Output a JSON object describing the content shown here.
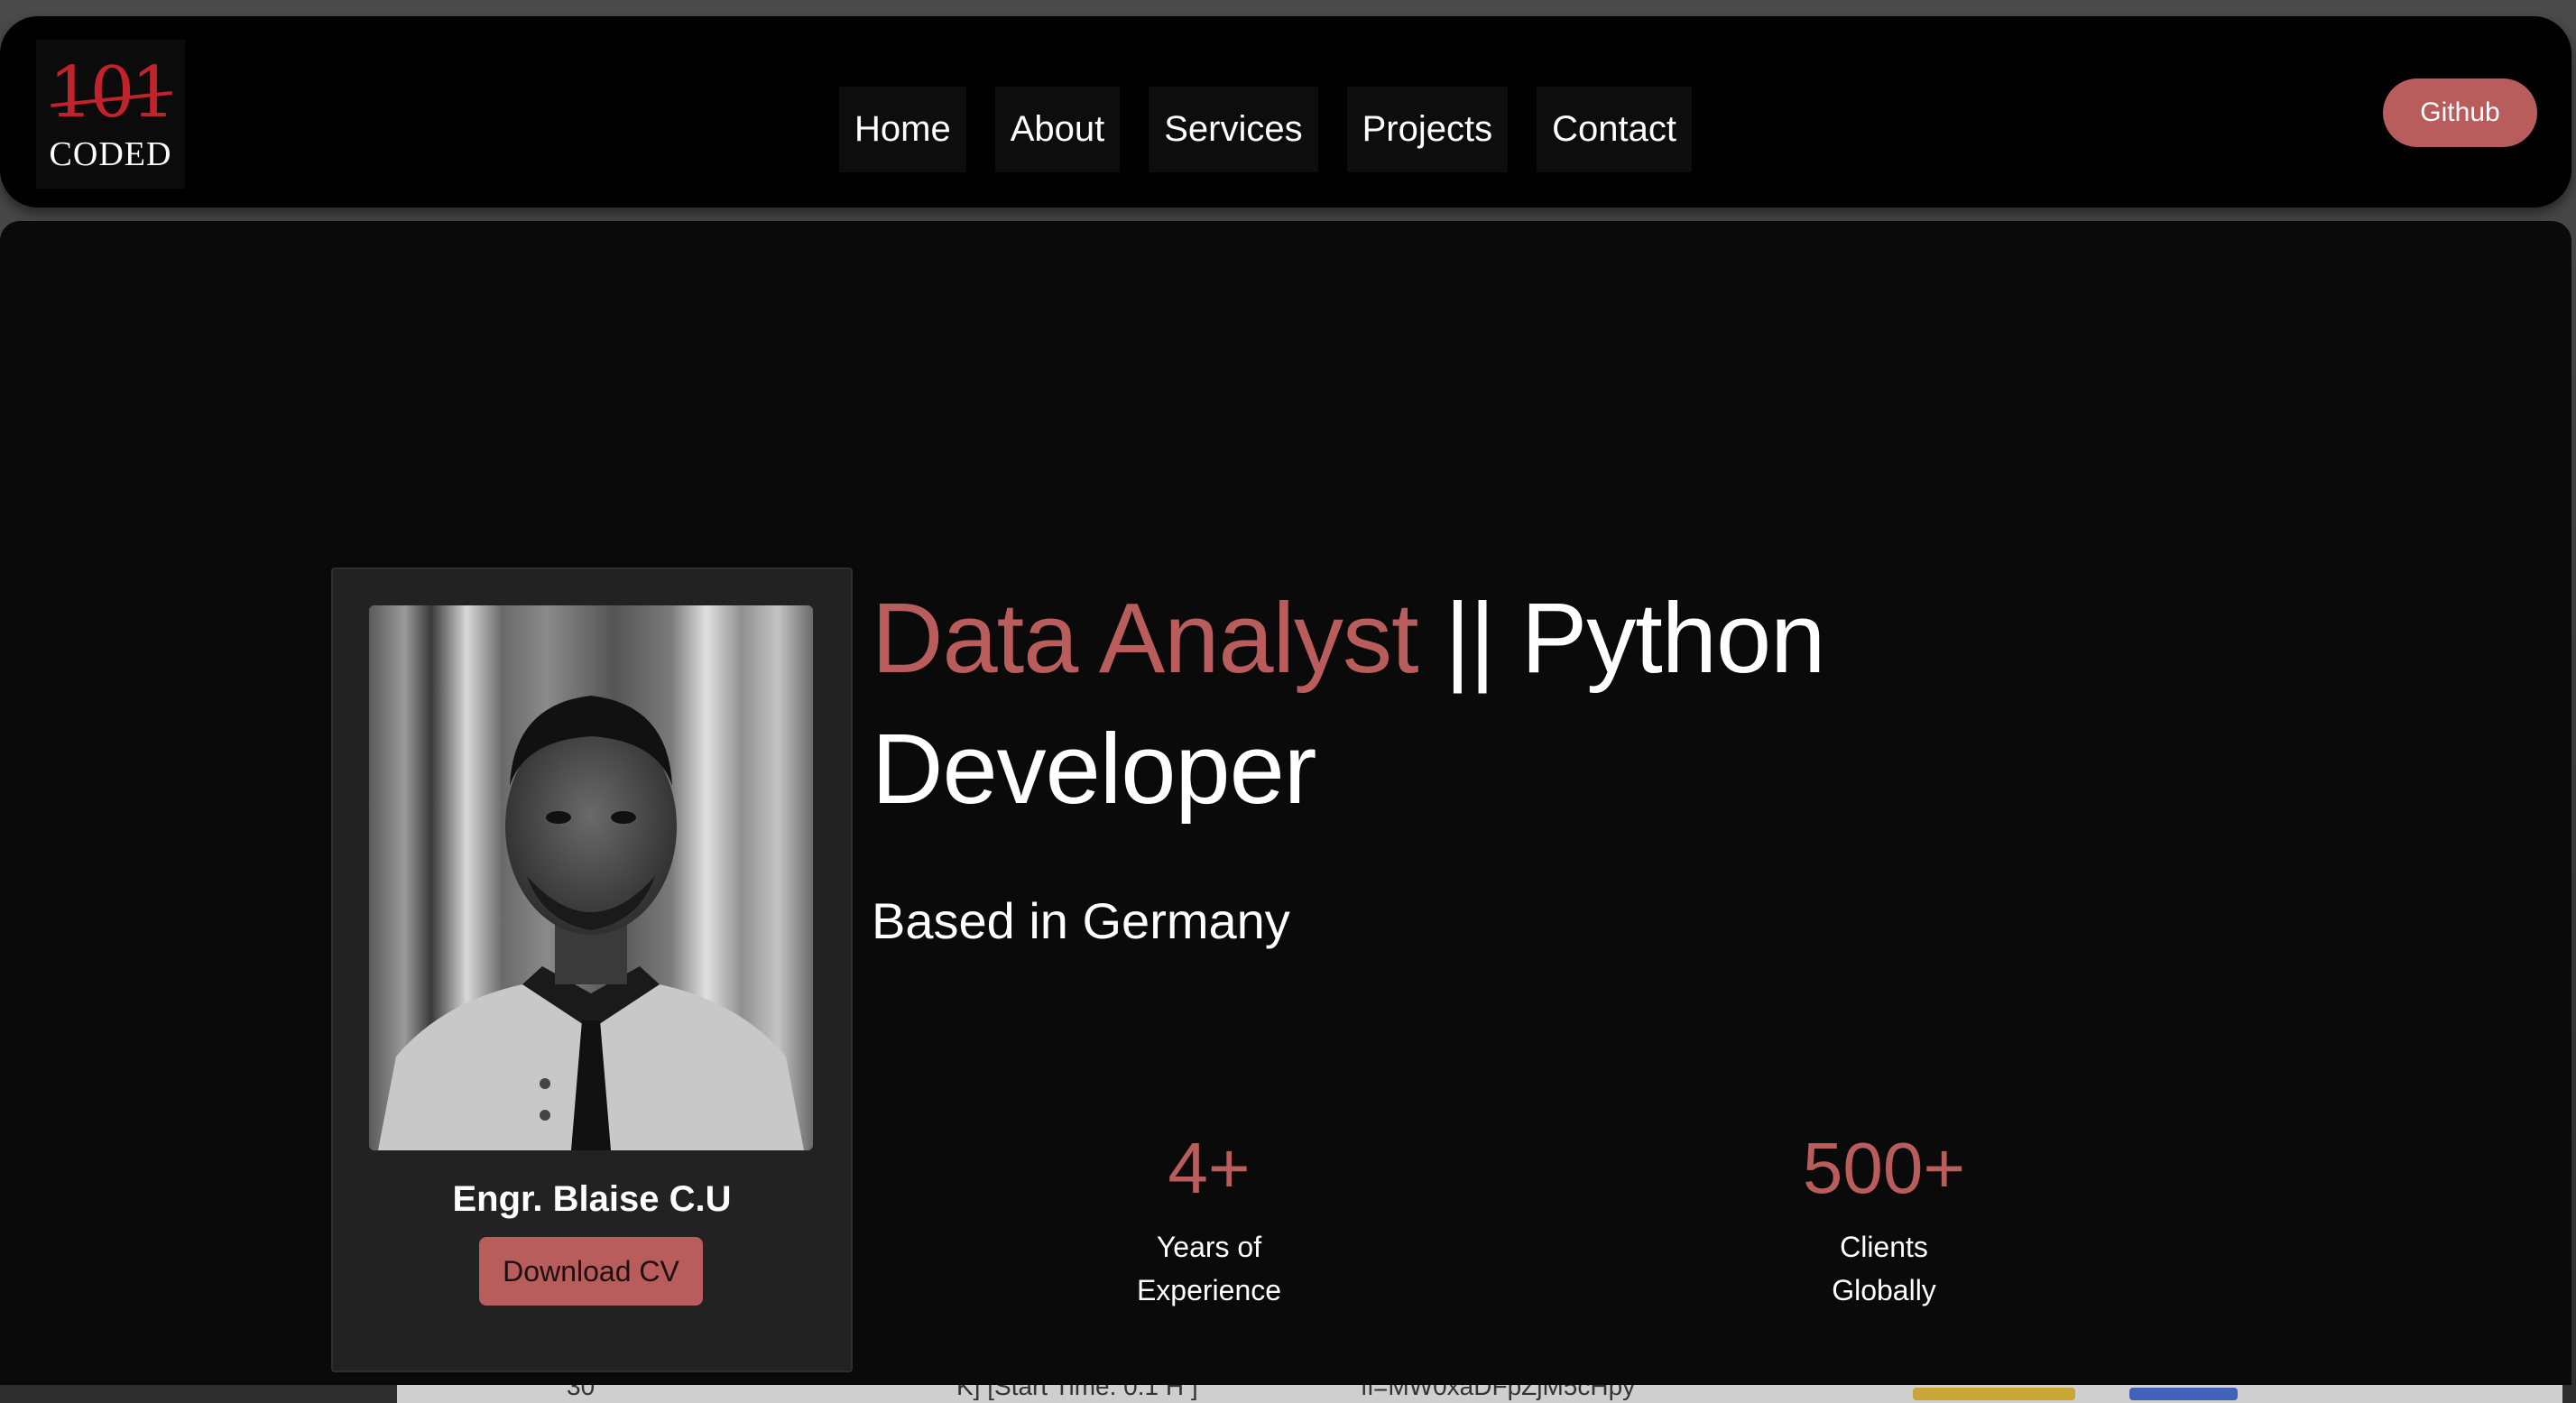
{
  "colors": {
    "accent": "#b85c5c",
    "logo_red": "#c0232b",
    "navbar_bg": "#000000",
    "hero_bg": "#0a0a0a",
    "card_bg": "#222222"
  },
  "logo": {
    "number": "101",
    "word": "CODED"
  },
  "nav": {
    "items": [
      {
        "label": "Home"
      },
      {
        "label": "About"
      },
      {
        "label": "Services"
      },
      {
        "label": "Projects"
      },
      {
        "label": "Contact"
      }
    ],
    "github_label": "Github"
  },
  "profile": {
    "name": "Engr. Blaise C.U",
    "download_label": "Download CV",
    "portrait_icon": "person-portrait-photo"
  },
  "hero": {
    "title_accent": "Data Analyst",
    "title_rest_line1": " || Python",
    "title_line2": "Developer",
    "location": "Based in Germany"
  },
  "stats": [
    {
      "value": "4+",
      "label": "Years of Experience"
    },
    {
      "value": "500+",
      "label": "Clients Globally"
    }
  ],
  "background_page": {
    "fragments": [
      "30",
      "K] [Start Time: 0:1 H ]",
      "fl=MW0xaDFpZjM5cHpy"
    ]
  }
}
